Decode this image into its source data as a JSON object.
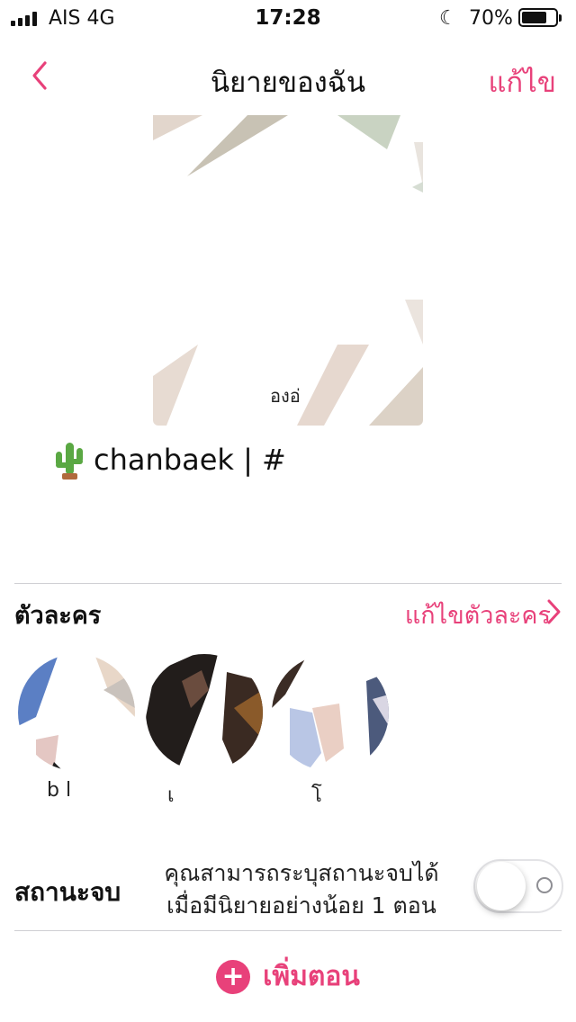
{
  "status_bar": {
    "carrier": "AIS   4G",
    "time": "17:28",
    "battery": "70%",
    "battery_level": 0.7
  },
  "nav": {
    "title": "นิยายของฉัน",
    "edit_label": "แก้ไข",
    "back_icon": "chevron-left-icon"
  },
  "cover": {
    "caption": "องอ่"
  },
  "story": {
    "icon": "cactus-icon",
    "title": "chanbaek | #"
  },
  "characters": {
    "section_title": "ตัวละคร",
    "edit_label": "แก้ไขตัวละคร",
    "items": [
      {
        "name": "b l"
      },
      {
        "name": "เ"
      },
      {
        "name": "โ"
      }
    ]
  },
  "ending": {
    "label": "สถานะจบ",
    "note_line1": "คุณสามารถระบุสถานะจบได้",
    "note_line2": "เมื่อมีนิยายอย่างน้อย 1 ตอน",
    "toggle_on": false
  },
  "add_episode": {
    "label": "เพิ่มตอน"
  },
  "colors": {
    "accent": "#e8417a",
    "divider": "#cfcfd3"
  }
}
